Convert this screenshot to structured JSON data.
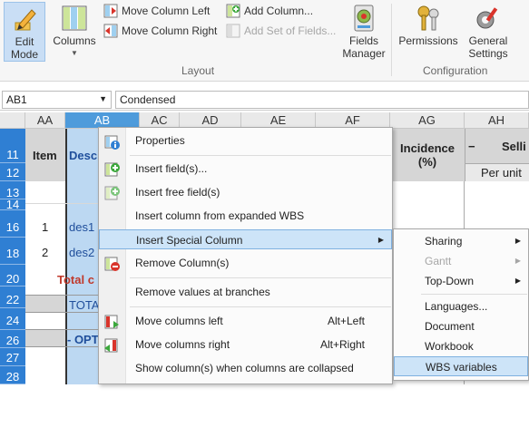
{
  "ribbon": {
    "edit_mode": "Edit Mode",
    "columns": "Columns",
    "move_left": "Move Column Left",
    "move_right": "Move Column Right",
    "add_column": "Add Column...",
    "add_set": "Add Set of Fields...",
    "fields_manager": "Fields Manager",
    "permissions": "Permissions",
    "general_settings": "General Settings",
    "group_layout": "Layout",
    "group_config": "Configuration"
  },
  "formula_bar": {
    "cell_ref": "AB1",
    "value": "Condensed"
  },
  "columns": [
    "AA",
    "AB",
    "AC",
    "AD",
    "AE",
    "AF",
    "AG",
    "AH"
  ],
  "rows": [
    "11",
    "12",
    "13",
    "14",
    "16",
    "18",
    "20",
    "22",
    "24",
    "26",
    "27",
    "28"
  ],
  "cells": {
    "item_header": "Item",
    "desc_header": "Desc",
    "incidence_header": "Incidence (%)",
    "selling_header": "Selli",
    "selling_minus": "−",
    "per_unit": "Per unit",
    "r16_item": "1",
    "r16_desc": "des1",
    "r18_item": "2",
    "r18_desc": "des2",
    "r20_total": "Total c",
    "r22_total": "TOTA",
    "r26_opt": "- OPT"
  },
  "context_menu": {
    "properties": "Properties",
    "insert_fields": "Insert field(s)...",
    "insert_free": "Insert free field(s)",
    "insert_wbs": "Insert column from expanded WBS",
    "insert_special": "Insert Special Column",
    "remove_columns": "Remove Column(s)",
    "remove_values": "Remove values at branches",
    "move_left": "Move columns left",
    "move_left_sc": "Alt+Left",
    "move_right": "Move columns right",
    "move_right_sc": "Alt+Right",
    "show_collapsed": "Show column(s) when columns are collapsed"
  },
  "submenu": {
    "sharing": "Sharing",
    "gantt": "Gantt",
    "topdown": "Top-Down",
    "languages": "Languages...",
    "document": "Document",
    "workbook": "Workbook",
    "wbs_variables": "WBS variables"
  },
  "colors": {
    "accent": "#2f7fd3",
    "selected_col": "#4e9bdb",
    "highlight": "#cde4f8",
    "total_red": "#c0392b",
    "desc_blue": "#1f4e9b"
  }
}
